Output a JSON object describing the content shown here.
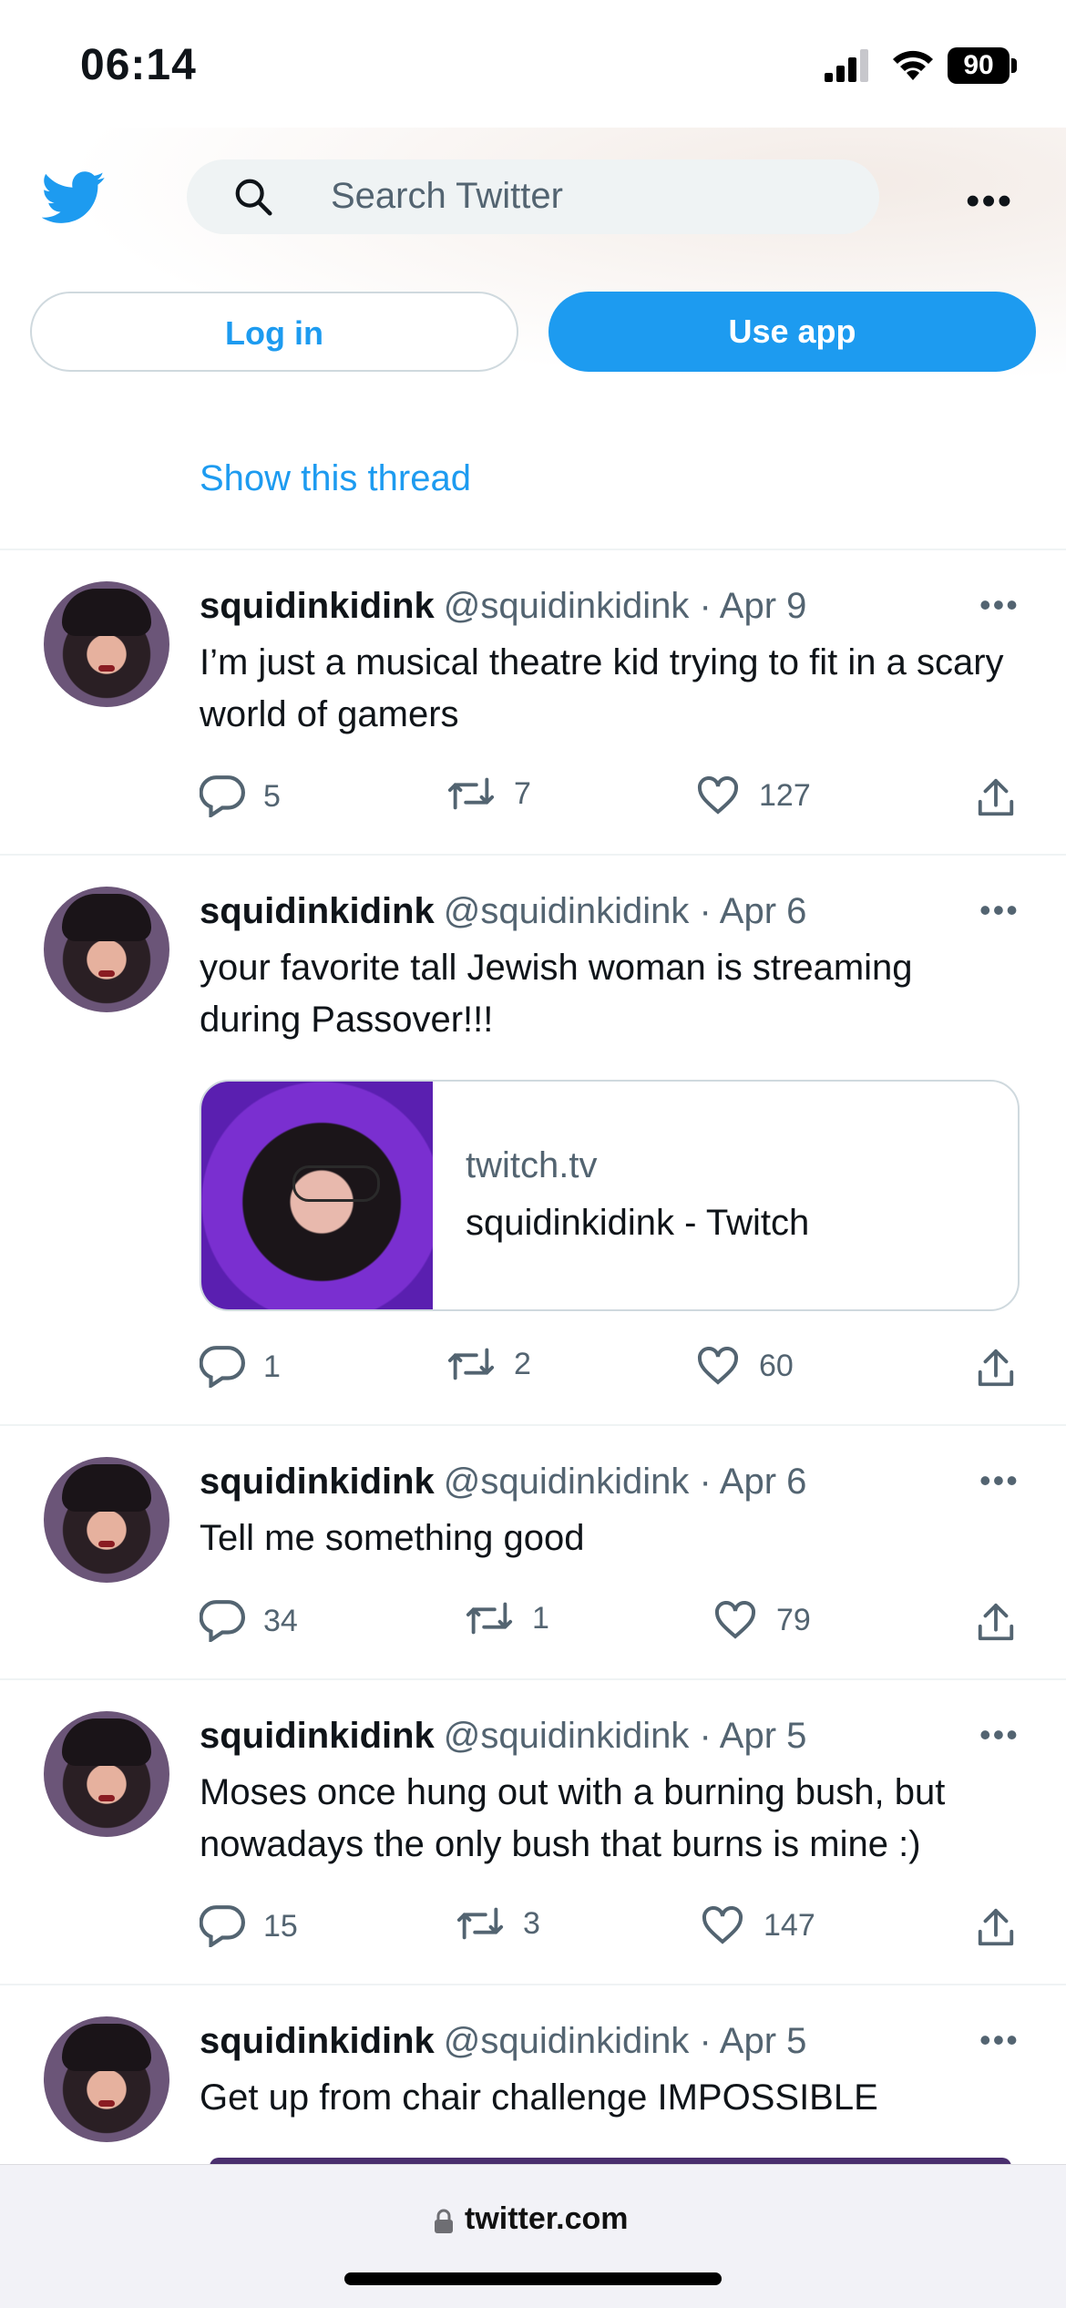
{
  "status_bar": {
    "time": "06:14",
    "battery": "90"
  },
  "header": {
    "search_placeholder": "Search Twitter",
    "more_label": "•••",
    "login_label": "Log in",
    "use_app_label": "Use app"
  },
  "thread_link": "Show this thread",
  "icons": {
    "logo": "twitter-bird-icon",
    "search": "search-icon",
    "reply": "reply-icon",
    "retweet": "retweet-icon",
    "like": "heart-icon",
    "share": "share-icon",
    "more": "more-icon",
    "lock": "lock-icon"
  },
  "colors": {
    "brand": "#1d9bf0",
    "secondary_text": "#536471"
  },
  "tweets": [
    {
      "name": "squidinkidink",
      "handle": "@squidinkidink · Apr 9",
      "text": "I’m just a musical theatre kid trying to fit in a scary world of gamers",
      "replies": "5",
      "retweets": "7",
      "likes": "127"
    },
    {
      "name": "squidinkidink",
      "handle": "@squidinkidink · Apr 6",
      "text": "your favorite tall Jewish woman is streaming during Passover!!!",
      "replies": "1",
      "retweets": "2",
      "likes": "60",
      "card": {
        "domain": "twitch.tv",
        "title": "squidinkidink - Twitch"
      }
    },
    {
      "name": "squidinkidink",
      "handle": "@squidinkidink · Apr 6",
      "text": "Tell me something good",
      "replies": "34",
      "retweets": "1",
      "likes": "79"
    },
    {
      "name": "squidinkidink",
      "handle": "@squidinkidink · Apr 5",
      "text": "Moses once hung out with a burning bush, but nowadays the only bush that burns is mine :)",
      "replies": "15",
      "retweets": "3",
      "likes": "147"
    },
    {
      "name": "squidinkidink",
      "handle": "@squidinkidink · Apr 5",
      "text": "Get up from chair challenge IMPOSSIBLE"
    }
  ],
  "browser": {
    "url": "twitter.com"
  }
}
